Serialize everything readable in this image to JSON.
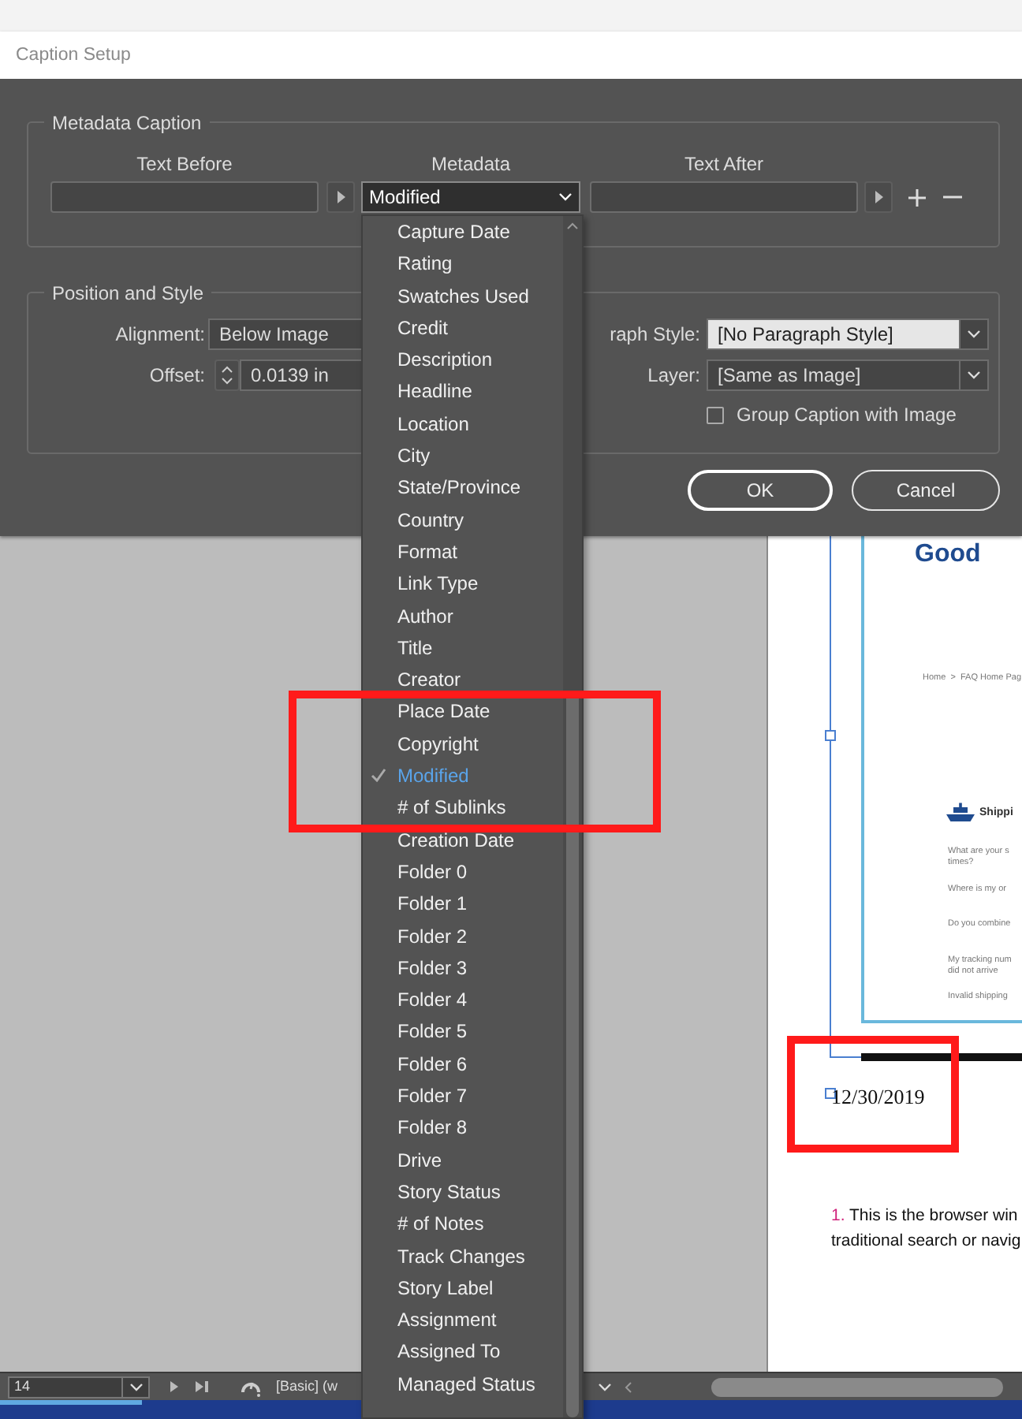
{
  "dialog": {
    "title": "Caption Setup",
    "metadata_caption": {
      "legend": "Metadata Caption",
      "columns": [
        "Text Before",
        "Metadata",
        "Text After"
      ],
      "metadata_value": "Modified"
    },
    "position_and_style": {
      "legend": "Position and Style",
      "alignment": {
        "label": "Alignment:",
        "value": "Below Image"
      },
      "offset": {
        "label": "Offset:",
        "value": "0.0139 in"
      },
      "paragraph_style": {
        "label": "raph Style:",
        "value": "[No Paragraph Style]"
      },
      "layer": {
        "label": "Layer:",
        "value": "[Same as Image]"
      },
      "group_caption": {
        "label": "Group Caption with Image",
        "checked": false
      }
    },
    "buttons": [
      {
        "label": "OK",
        "default": true
      },
      {
        "label": "Cancel",
        "default": false
      }
    ]
  },
  "dropdown": {
    "items": [
      {
        "label": "Capture Date",
        "selected": false
      },
      {
        "label": "Rating",
        "selected": false
      },
      {
        "label": "Swatches Used",
        "selected": false
      },
      {
        "label": "Credit",
        "selected": false
      },
      {
        "label": "Description",
        "selected": false
      },
      {
        "label": "Headline",
        "selected": false
      },
      {
        "label": "Location",
        "selected": false
      },
      {
        "label": "City",
        "selected": false
      },
      {
        "label": "State/Province",
        "selected": false
      },
      {
        "label": "Country",
        "selected": false
      },
      {
        "label": "Format",
        "selected": false
      },
      {
        "label": "Link Type",
        "selected": false
      },
      {
        "label": "Author",
        "selected": false
      },
      {
        "label": "Title",
        "selected": false
      },
      {
        "label": "Creator",
        "selected": false
      },
      {
        "label": "Place Date",
        "selected": false
      },
      {
        "label": "Copyright",
        "selected": false
      },
      {
        "label": "Modified",
        "selected": true
      },
      {
        "label": "# of Sublinks",
        "selected": false
      },
      {
        "label": "Creation Date",
        "selected": false
      },
      {
        "label": "Folder 0",
        "selected": false
      },
      {
        "label": "Folder 1",
        "selected": false
      },
      {
        "label": "Folder 2",
        "selected": false
      },
      {
        "label": "Folder 3",
        "selected": false
      },
      {
        "label": "Folder 4",
        "selected": false
      },
      {
        "label": "Folder 5",
        "selected": false
      },
      {
        "label": "Folder 6",
        "selected": false
      },
      {
        "label": "Folder 7",
        "selected": false
      },
      {
        "label": "Folder 8",
        "selected": false
      },
      {
        "label": "Drive",
        "selected": false
      },
      {
        "label": "Story Status",
        "selected": false
      },
      {
        "label": "# of Notes",
        "selected": false
      },
      {
        "label": "Track Changes",
        "selected": false
      },
      {
        "label": "Story Label",
        "selected": false
      },
      {
        "label": "Assignment",
        "selected": false
      },
      {
        "label": "Assigned To",
        "selected": false
      },
      {
        "label": "Managed Status",
        "selected": false
      }
    ]
  },
  "document": {
    "logo": "Good",
    "breadcrumb": "Home  >  FAQ Home Pag",
    "section": "Shippi",
    "questions": [
      "What are your s\ntimes?",
      "Where is my or",
      "Do you combine",
      "My tracking num\ndid not arrive",
      "Invalid shipping"
    ],
    "caption": "12/30/2019",
    "note_number": "1.",
    "note_text": "This is the browser win\ntraditional search or navig"
  },
  "status_bar": {
    "page": "14",
    "style": "[Basic] (w"
  }
}
